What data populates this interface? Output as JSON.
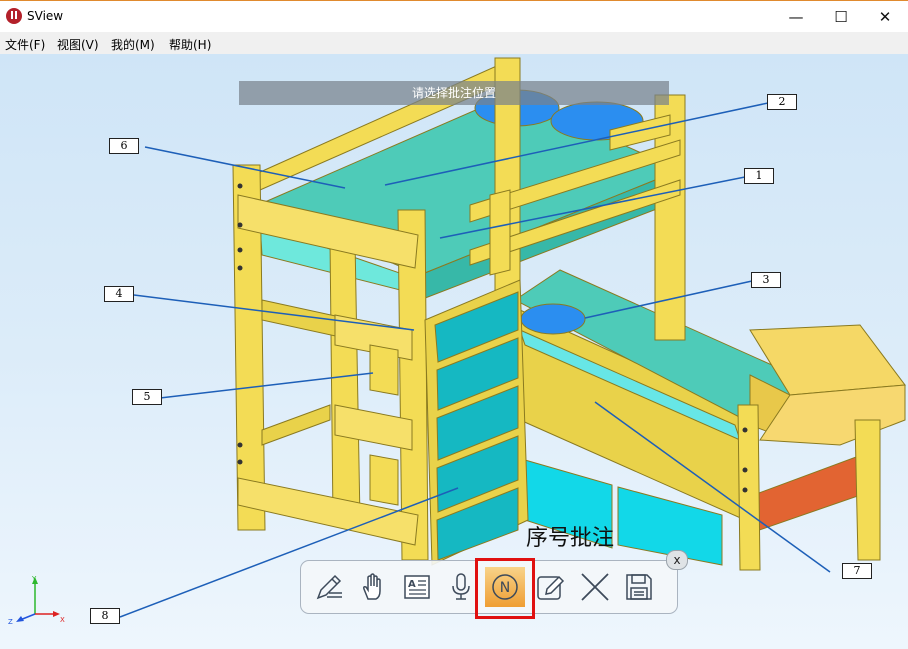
{
  "app": {
    "title": "SView"
  },
  "window_controls": {
    "minimize": "—",
    "maximize": "☐",
    "close": "✕"
  },
  "menu": [
    "文件(F)",
    "视图(V)",
    "我的(M)",
    "帮助(H)"
  ],
  "hint": "请选择批注位置",
  "callouts": [
    "1",
    "2",
    "3",
    "4",
    "5",
    "6",
    "7",
    "8"
  ],
  "tool_label": "序号批注",
  "toolbar": {
    "close_label": "x",
    "tools": [
      "annotate-text-icon",
      "hand-icon",
      "text-note-icon",
      "microphone-icon",
      "number-annotation-icon",
      "edit-icon",
      "delete-icon",
      "save-icon"
    ],
    "active": "number-annotation-icon",
    "number_glyph": "N"
  },
  "axes": {
    "y": "Y",
    "z": "Z",
    "x": "X"
  },
  "colors": {
    "frame": "#f3dc55",
    "mattress": "#4ecbb8",
    "pillow": "#2b8ef0",
    "drawer": "#17b9c2",
    "rail": "#e06030",
    "leader": "#1d5fb8"
  }
}
